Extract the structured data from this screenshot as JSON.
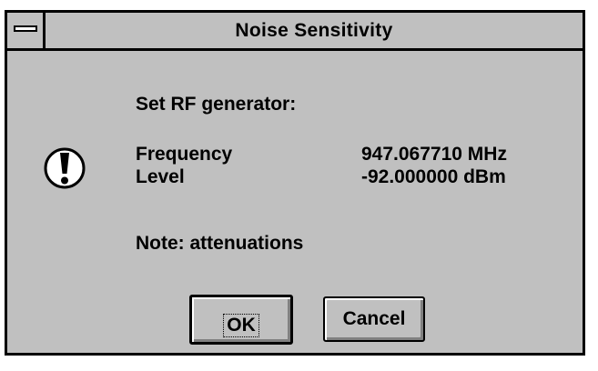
{
  "window": {
    "title": "Noise Sensitivity"
  },
  "message": {
    "heading": "Set RF generator:",
    "rows": [
      {
        "label": "Frequency",
        "value": "947.067710 MHz"
      },
      {
        "label": "Level",
        "value": "-92.000000 dBm"
      }
    ],
    "note": "Note: attenuations"
  },
  "icon": {
    "name": "exclamation-icon"
  },
  "buttons": {
    "ok_label": "OK",
    "cancel_label": "Cancel"
  },
  "colors": {
    "face": "#c0c0c0",
    "frame": "#000000",
    "highlight": "#ffffff",
    "shadow": "#808080"
  }
}
